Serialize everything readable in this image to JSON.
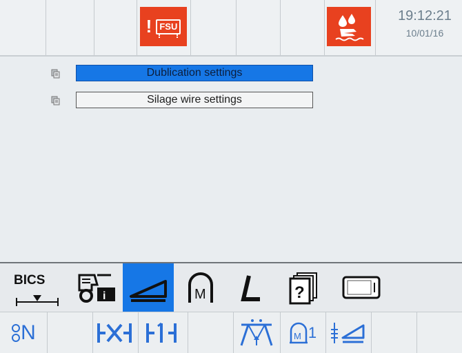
{
  "status_bar": {
    "alarm_badge": "FSU",
    "alarm_mark": "!",
    "time": "19:12:21",
    "date": "10/01/16"
  },
  "menu": {
    "items": [
      {
        "label": "Dublication settings",
        "selected": true
      },
      {
        "label": "Silage wire settings",
        "selected": false
      }
    ]
  },
  "softkeys": {
    "bics_label": "BICS",
    "icons": [
      "bics-icon",
      "baler-info-icon",
      "wedge-icon",
      "m-arch-icon",
      "l-icon",
      "help-pages-icon",
      "screen-icon"
    ],
    "active_index": 2
  },
  "bottom_bar": {
    "n_label": "N",
    "one_label": "1",
    "icons": [
      "n-icon",
      "x-bracket-icon",
      "one-bracket-icon",
      "pickup-icon",
      "m1-icon",
      "wedge-adjust-icon"
    ]
  },
  "colors": {
    "alarm": "#e8411f",
    "accent": "#1677e6",
    "icon_blue": "#2b6fd6"
  }
}
